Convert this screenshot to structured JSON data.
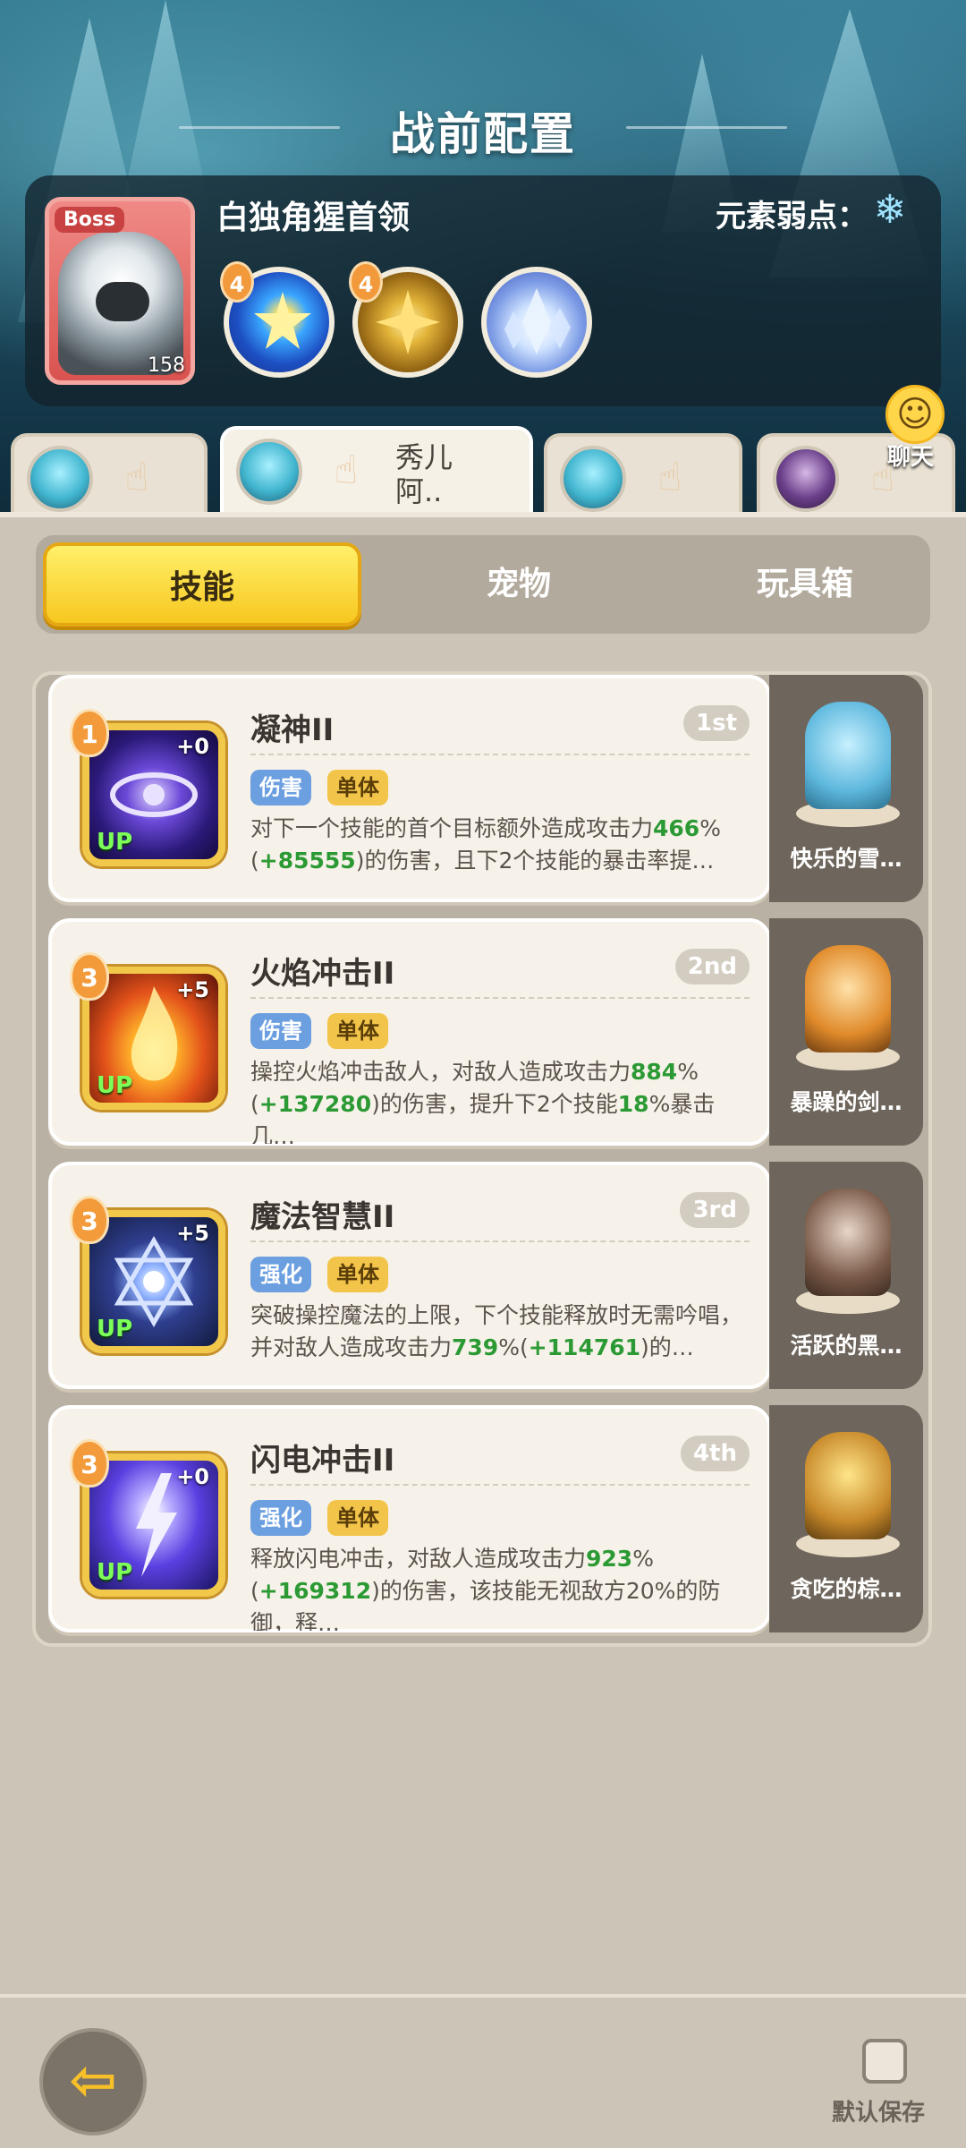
{
  "header": {
    "title": "战前配置"
  },
  "boss": {
    "tag": "Boss",
    "name": "白独角猩首领",
    "level": "158",
    "weakness_label": "元素弱点：",
    "weakness_icon": "snowflake-icon",
    "skills": [
      {
        "level": "4",
        "icon": "star-swirl-icon"
      },
      {
        "level": "4",
        "icon": "golden-burst-icon"
      },
      {
        "level": "",
        "icon": "ice-crystal-icon"
      }
    ]
  },
  "team_tabs": [
    {
      "name": "",
      "active": false
    },
    {
      "name": "秀儿阿..",
      "active": true
    },
    {
      "name": "",
      "active": false
    },
    {
      "name": "",
      "active": false
    }
  ],
  "chat": {
    "label": "聊天"
  },
  "segments": {
    "skill": "技能",
    "pet": "宠物",
    "toybox": "玩具箱",
    "active": "技能"
  },
  "skills": [
    {
      "level": "1",
      "plus": "+0",
      "up": "UP",
      "name": "凝神II",
      "order": "1st",
      "tags": [
        "伤害",
        "单体"
      ],
      "desc_parts": [
        "对下一个技能的首个目标额外造成攻击力",
        "466",
        "%(",
        "+85555",
        ")的伤害，且下2个技能的暴击率提…"
      ],
      "pet": "快乐的雪…"
    },
    {
      "level": "3",
      "plus": "+5",
      "up": "UP",
      "name": "火焰冲击II",
      "order": "2nd",
      "tags": [
        "伤害",
        "单体"
      ],
      "desc_parts": [
        "操控火焰冲击敌人，对敌人造成攻击力",
        "884",
        "%(",
        "+137280",
        ")的伤害，提升下2个技能",
        "18",
        "%暴击几…"
      ],
      "pet": "暴躁的剑…"
    },
    {
      "level": "3",
      "plus": "+5",
      "up": "UP",
      "name": "魔法智慧II",
      "order": "3rd",
      "tags": [
        "强化",
        "单体"
      ],
      "desc_parts": [
        "突破操控魔法的上限，下个技能释放时无需吟唱，并对敌人造成攻击力",
        "739",
        "%(",
        "+114761",
        ")的…"
      ],
      "pet": "活跃的黑…"
    },
    {
      "level": "3",
      "plus": "+0",
      "up": "UP",
      "name": "闪电冲击II",
      "order": "4th",
      "tags": [
        "强化",
        "单体"
      ],
      "desc_parts": [
        "释放闪电冲击，对敌人造成攻击力",
        "923",
        "%(",
        "+169312",
        ")的伤害，该技能无视敌方20%的防御，释…"
      ],
      "pet": "贪吃的棕…"
    }
  ],
  "footer": {
    "save_label": "默认保存",
    "save_checked": false
  },
  "colors": {
    "accent_yellow": "#f7c71f",
    "green_value": "#2c9a34",
    "tag_blue": "#6b9fe0",
    "tag_yellow": "#f2c44a"
  }
}
